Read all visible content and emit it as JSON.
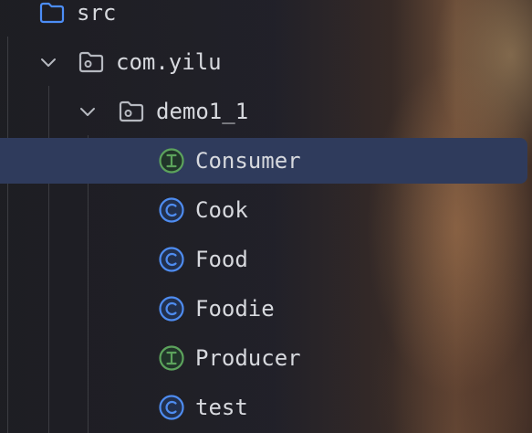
{
  "project_tree": {
    "nodes": [
      {
        "label": "src",
        "icon": "source-folder-icon",
        "expanded": true
      },
      {
        "label": "com.yilu",
        "icon": "package-folder-icon",
        "expanded": true
      },
      {
        "label": "demo1_1",
        "icon": "package-folder-icon",
        "expanded": true
      },
      {
        "label": "Consumer",
        "icon": "interface-icon",
        "selected": true
      },
      {
        "label": "Cook",
        "icon": "class-icon"
      },
      {
        "label": "Food",
        "icon": "class-icon"
      },
      {
        "label": "Foodie",
        "icon": "class-icon"
      },
      {
        "label": "Producer",
        "icon": "interface-icon"
      },
      {
        "label": "test",
        "icon": "class-icon"
      }
    ]
  },
  "colors": {
    "selection": "#2f3b5c",
    "class_icon": "#4e8cf0",
    "interface_icon": "#5ca35c",
    "text": "#d7d9de"
  }
}
